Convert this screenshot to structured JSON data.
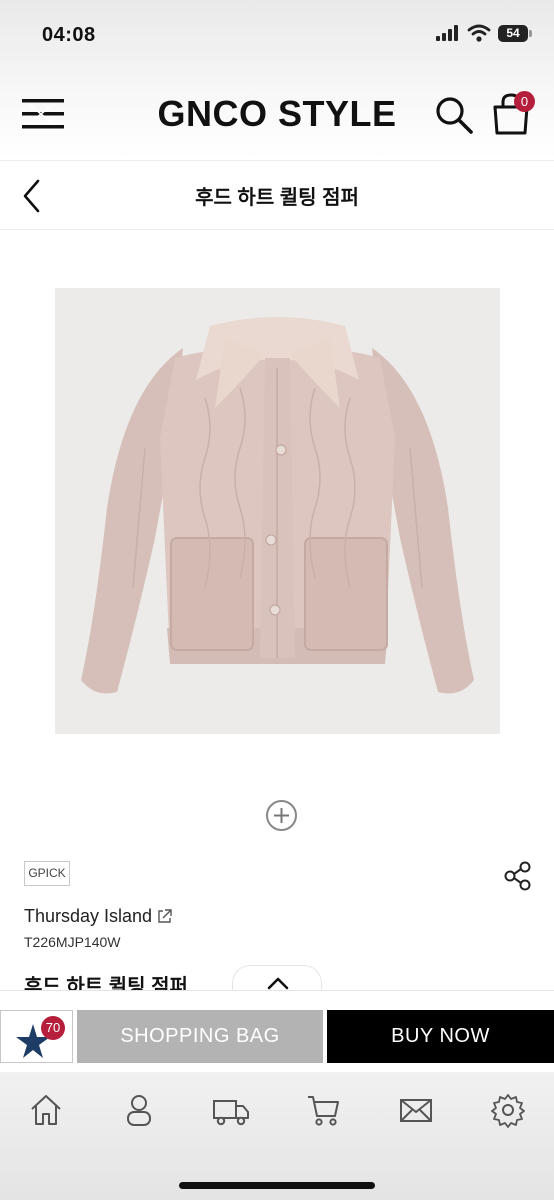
{
  "status_bar": {
    "time": "04:08",
    "battery": "54"
  },
  "header": {
    "logo": "GNCO STYLE",
    "cart_count": "0"
  },
  "title_bar": {
    "title": "후드 하트 퀼팅 점퍼"
  },
  "product": {
    "badge": "GPICK",
    "brand": "Thursday Island",
    "code": "T226MJP140W",
    "name": "후드 하트 퀼팅 점퍼"
  },
  "action_bar": {
    "wish_count": "70",
    "shopping_bag_label": "SHOPPING BAG",
    "buy_now_label": "BUY NOW"
  },
  "bottom_nav": {
    "items": [
      "home-icon",
      "user-icon",
      "truck-icon",
      "cart-icon",
      "mail-icon",
      "gear-icon"
    ]
  },
  "colors": {
    "accent": "#b51f3b",
    "buy": "#000000",
    "shopping_bag": "#b3b3b3",
    "jacket": "#d9c2bb",
    "star": "#1e3d66"
  }
}
